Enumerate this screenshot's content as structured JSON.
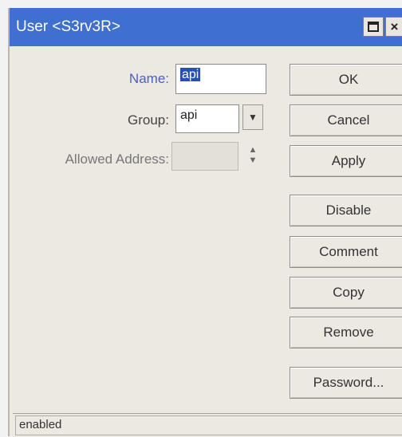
{
  "window": {
    "title": "User <S3rv3R>",
    "close_glyph": "×"
  },
  "form": {
    "name_label": "Name:",
    "name_value": "api",
    "group_label": "Group:",
    "group_value": "api",
    "address_label": "Allowed Address:",
    "address_value": ""
  },
  "icons": {
    "dropdown": "▼",
    "updown_up": "▲",
    "updown_down": "▼"
  },
  "buttons": {
    "ok": "OK",
    "cancel": "Cancel",
    "apply": "Apply",
    "disable": "Disable",
    "comment": "Comment",
    "copy": "Copy",
    "remove": "Remove",
    "password": "Password..."
  },
  "status": {
    "text": "enabled"
  }
}
